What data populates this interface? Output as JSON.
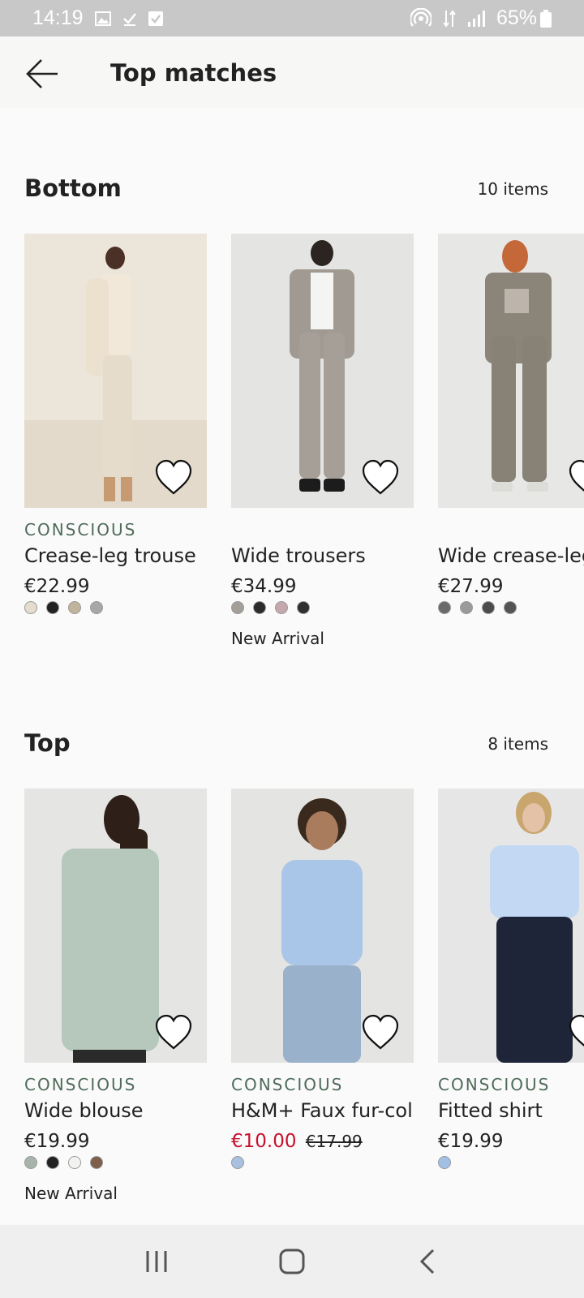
{
  "status_bar": {
    "time": "14:19",
    "battery": "65%",
    "left_icons": [
      "gallery-icon",
      "check-icon",
      "checkbox-icon"
    ],
    "right_icons": [
      "hotspot-icon",
      "data-arrows-icon",
      "signal-icon",
      "battery-icon"
    ]
  },
  "header": {
    "title": "Top matches",
    "back_icon": "back-arrow-icon"
  },
  "sections": [
    {
      "title": "Bottom",
      "count": "10 items",
      "products": [
        {
          "tag": "CONSCIOUS",
          "name": "Crease-leg trouse",
          "price": "€22.99",
          "swatches": [
            "#e4dccd",
            "#222222",
            "#c2b49c",
            "#a9a6a8"
          ],
          "badge": ""
        },
        {
          "tag": "",
          "name": "Wide trousers",
          "price": "€34.99",
          "swatches": [
            "#a39e98",
            "#2b2b2b",
            "#c4a8ae",
            "#2f2f2f"
          ],
          "badge": "New Arrival"
        },
        {
          "tag": "",
          "name": "Wide crease-leg",
          "price": "€27.99",
          "swatches": [
            "#6b6a6a",
            "#9a9a98",
            "#4b4b4b",
            "#545454"
          ],
          "badge": ""
        }
      ]
    },
    {
      "title": "Top",
      "count": "8 items",
      "products": [
        {
          "tag": "CONSCIOUS",
          "name": "Wide blouse",
          "price": "€19.99",
          "swatches": [
            "#a8b4ab",
            "#222222",
            "#f2f2f0",
            "#7d5f4c"
          ],
          "badge": "New Arrival"
        },
        {
          "tag": "CONSCIOUS",
          "name": "H&M+ Faux fur-col",
          "price": "€10.00",
          "old_price": "€17.99",
          "swatches": [
            "#a9c0e0"
          ],
          "badge": ""
        },
        {
          "tag": "CONSCIOUS",
          "name": "Fitted shirt",
          "price": "€19.99",
          "swatches": [
            "#a2c0e6"
          ],
          "badge": ""
        }
      ]
    }
  ],
  "colors": {
    "sale": "#c8102e",
    "conscious_tag": "#4f6b5a",
    "status_bar": "#c8c8c8"
  },
  "nav_bar": {
    "items": [
      "recent-apps-icon",
      "home-icon",
      "back-icon"
    ]
  }
}
